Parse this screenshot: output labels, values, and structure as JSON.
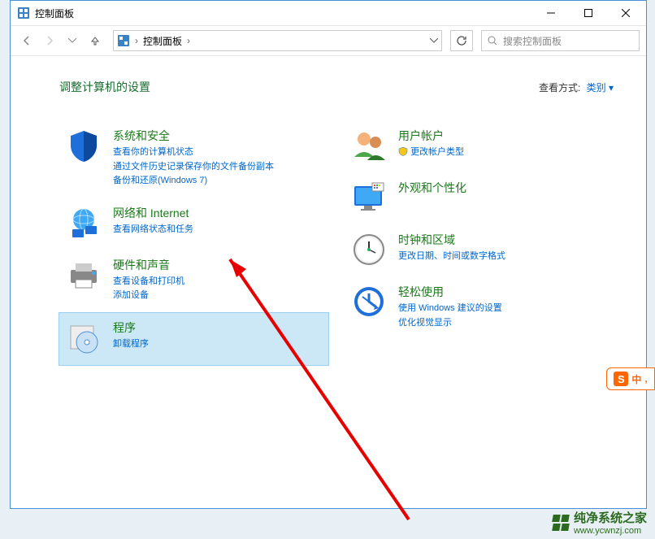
{
  "window": {
    "title": "控制面板"
  },
  "nav": {
    "crumb": "控制面板",
    "sep": "›"
  },
  "search": {
    "placeholder": "搜索控制面板"
  },
  "heading": "调整计算机的设置",
  "viewby": {
    "label": "查看方式:",
    "value": "类别"
  },
  "left": [
    {
      "title": "系统和安全",
      "subs": [
        "查看你的计算机状态",
        "通过文件历史记录保存你的文件备份副本",
        "备份和还原(Windows 7)"
      ]
    },
    {
      "title": "网络和 Internet",
      "subs": [
        "查看网络状态和任务"
      ]
    },
    {
      "title": "硬件和声音",
      "subs": [
        "查看设备和打印机",
        "添加设备"
      ]
    },
    {
      "title": "程序",
      "subs": [
        "卸载程序"
      ]
    }
  ],
  "right": [
    {
      "title": "用户帐户",
      "subs": [
        "更改帐户类型"
      ],
      "shield": true
    },
    {
      "title": "外观和个性化",
      "subs": []
    },
    {
      "title": "时钟和区域",
      "subs": [
        "更改日期、时间或数字格式"
      ]
    },
    {
      "title": "轻松使用",
      "subs": [
        "使用 Windows 建议的设置",
        "优化视觉显示"
      ]
    }
  ],
  "ime": "中",
  "watermark": {
    "name": "纯净系统之家",
    "url": "www.ycwnzj.com"
  }
}
